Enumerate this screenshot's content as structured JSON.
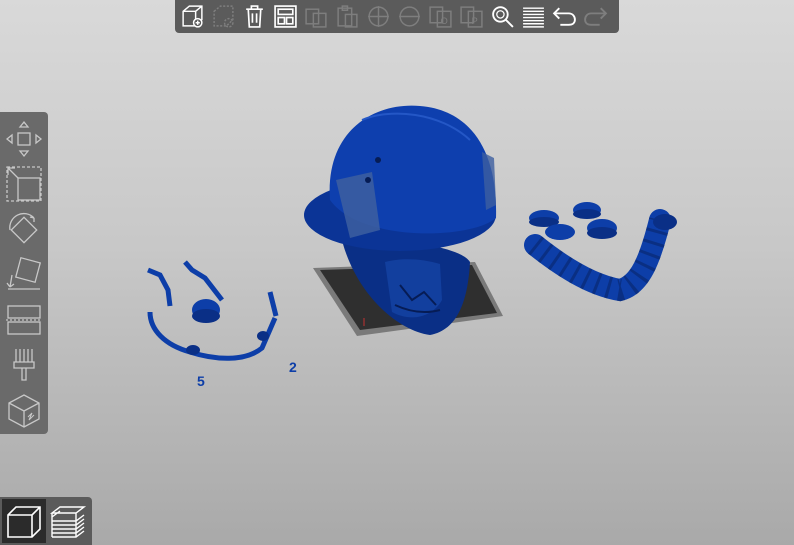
{
  "app": {
    "view": "3d-scene"
  },
  "toolbar": {
    "buttons": [
      {
        "name": "add-object",
        "icon": "add-cube-icon",
        "enabled": true
      },
      {
        "name": "delete",
        "icon": "delete-cube-icon",
        "enabled": false
      },
      {
        "name": "delete-all",
        "icon": "trash-icon",
        "enabled": true
      },
      {
        "name": "arrange",
        "icon": "arrange-icon",
        "enabled": true
      },
      {
        "name": "copy",
        "icon": "copy-icon",
        "enabled": false
      },
      {
        "name": "paste",
        "icon": "paste-icon",
        "enabled": false
      },
      {
        "name": "add-instance",
        "icon": "plus-circle-icon",
        "enabled": false
      },
      {
        "name": "remove-instance",
        "icon": "minus-circle-icon",
        "enabled": false
      },
      {
        "name": "split-to-objects",
        "icon": "split-objects-icon",
        "enabled": false
      },
      {
        "name": "split-to-parts",
        "icon": "split-parts-icon",
        "enabled": false
      },
      {
        "name": "search",
        "icon": "search-icon",
        "enabled": true
      },
      {
        "name": "layers-editing",
        "icon": "layers-icon",
        "enabled": true
      },
      {
        "name": "undo",
        "icon": "undo-icon",
        "enabled": true
      },
      {
        "name": "redo",
        "icon": "redo-icon",
        "enabled": false
      }
    ]
  },
  "gizmos": [
    {
      "name": "move",
      "icon": "move-icon"
    },
    {
      "name": "scale",
      "icon": "scale-icon"
    },
    {
      "name": "rotate",
      "icon": "rotate-icon"
    },
    {
      "name": "place-on-face",
      "icon": "place-on-face-icon"
    },
    {
      "name": "cut",
      "icon": "cut-icon"
    },
    {
      "name": "paint-supports",
      "icon": "paint-icon"
    },
    {
      "name": "hollow",
      "icon": "hollow-cube-icon"
    }
  ],
  "view_toggle": {
    "modes": [
      {
        "name": "3d-view",
        "icon": "cube-view-icon",
        "active": true
      },
      {
        "name": "preview",
        "icon": "layers-preview-icon",
        "active": false
      }
    ]
  },
  "colors": {
    "model": "#0d3ea8",
    "model_dark": "#08266b",
    "bed": "#2f2f2f",
    "toolbar": "#5b5b5b",
    "sidebar": "#6a6a6a",
    "icon": "#ffffff"
  }
}
